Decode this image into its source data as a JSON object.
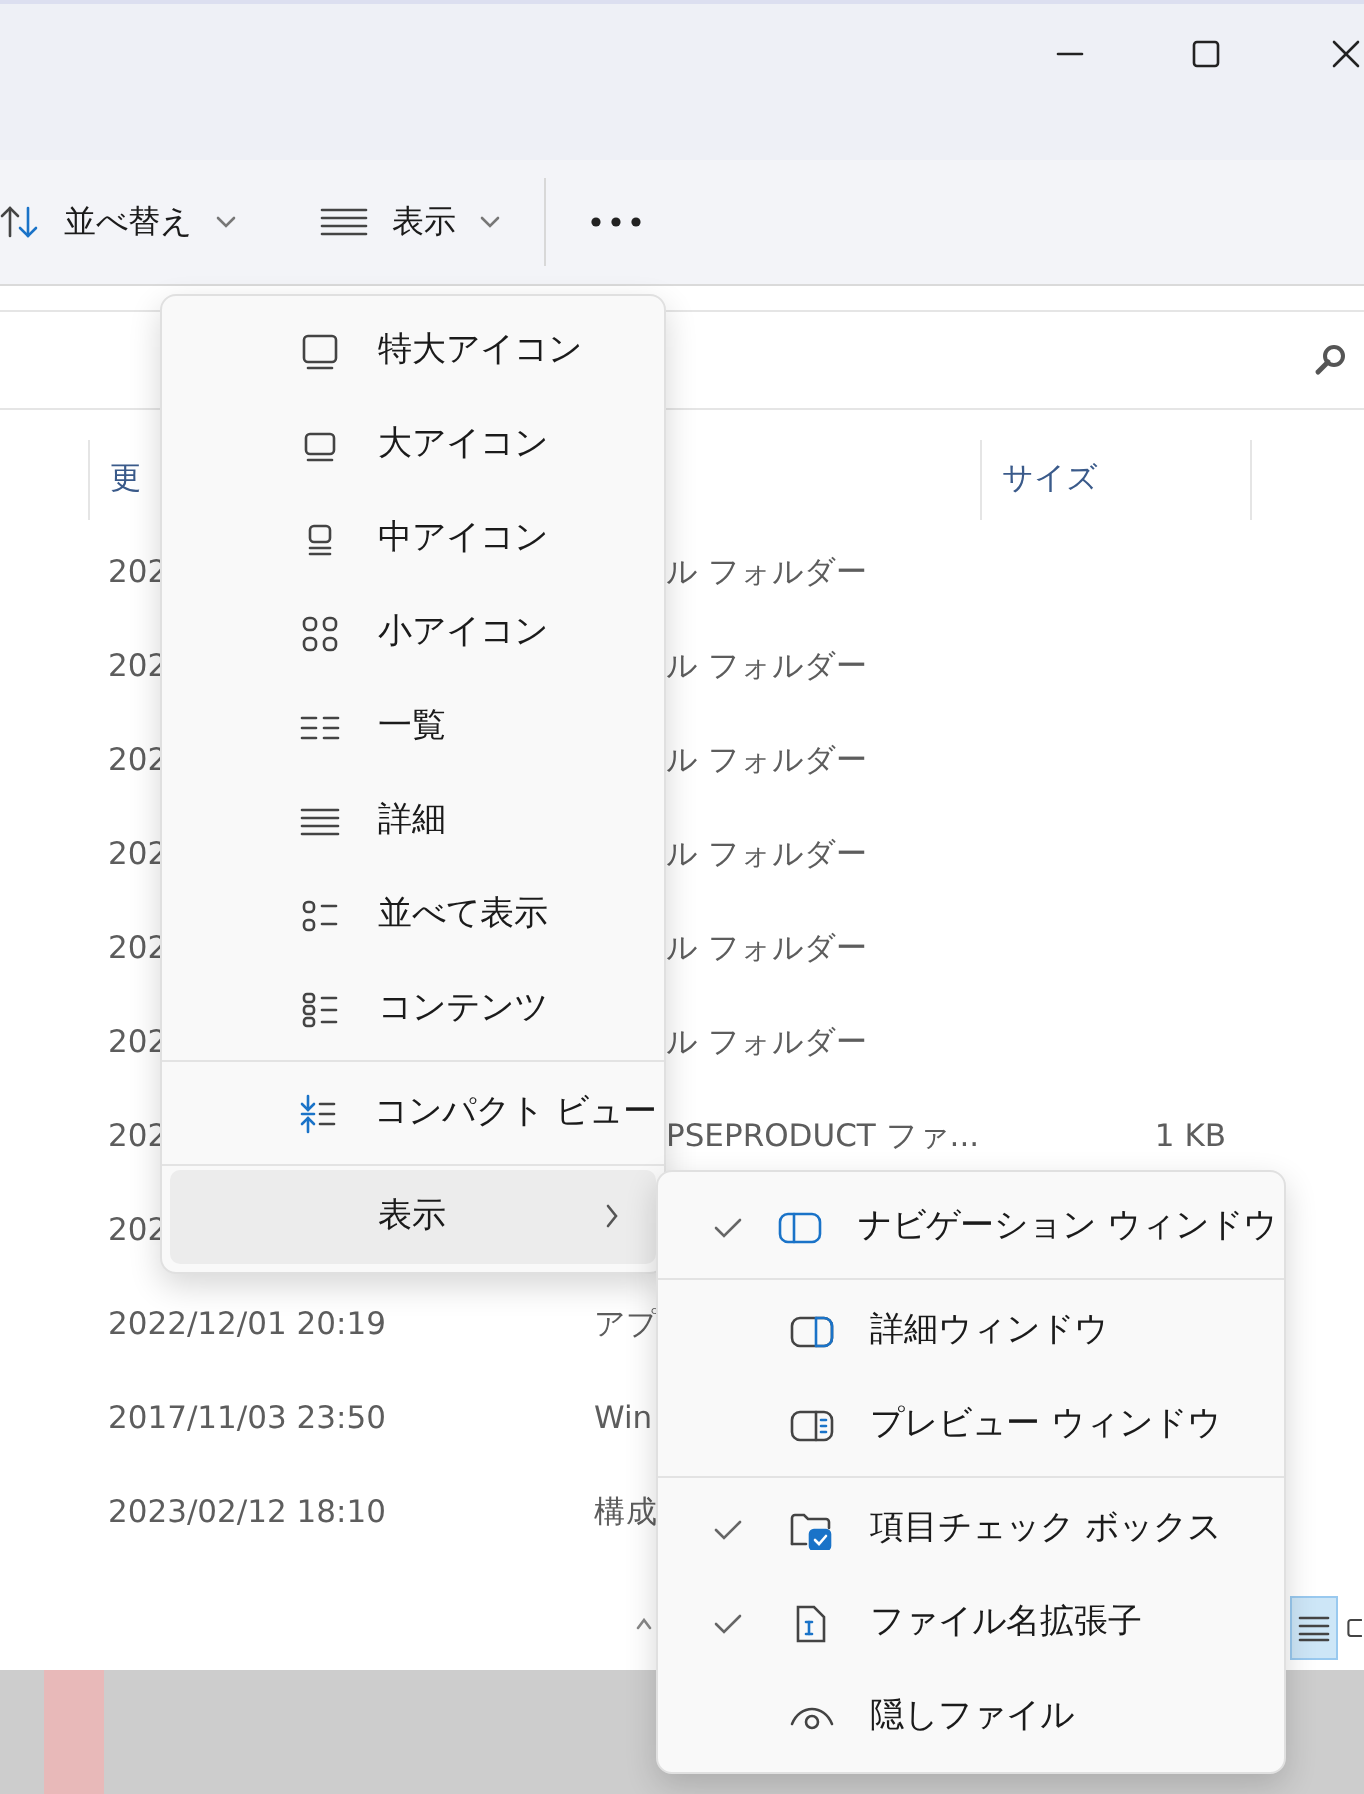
{
  "toolbar": {
    "items": [
      {
        "kind": "sort",
        "label": "並べ替え"
      },
      {
        "kind": "view",
        "label": "表示"
      },
      {
        "kind": "more"
      }
    ]
  },
  "file_list": {
    "columns": [
      {
        "kind": "date",
        "label": "更"
      },
      {
        "kind": "size",
        "label": "サイズ"
      }
    ],
    "rows": [
      {
        "date": "202",
        "type": "ル フォルダー",
        "covered": true
      },
      {
        "date": "202",
        "type": "ル フォルダー",
        "covered": true
      },
      {
        "date": "202",
        "type": "ル フォルダー",
        "covered": true
      },
      {
        "date": "202",
        "type": "ル フォルダー",
        "covered": true
      },
      {
        "date": "202",
        "type": "ル フォルダー",
        "covered": true
      },
      {
        "date": "202",
        "type": "ル フォルダー",
        "covered": true
      },
      {
        "date": "202",
        "type": "PSEPRODUCT ファ...",
        "size": "1 KB",
        "covered": true
      },
      {
        "date": "202"
      },
      {
        "date": "2022/12/01 20:19",
        "type": "アプ",
        "covered": false
      },
      {
        "date": "2017/11/03 23:50",
        "type": "Win",
        "covered": false
      },
      {
        "date": "2023/02/12 18:10",
        "type": "構成",
        "covered": false
      }
    ]
  },
  "view_menu": {
    "items": [
      {
        "kind": "option",
        "label": "特大アイコン",
        "highlighted": false
      },
      {
        "kind": "option",
        "label": "大アイコン",
        "highlighted": false
      },
      {
        "kind": "option",
        "label": "中アイコン",
        "highlighted": false
      },
      {
        "kind": "option",
        "label": "小アイコン",
        "highlighted": false
      },
      {
        "kind": "option",
        "label": "一覧",
        "highlighted": false
      },
      {
        "kind": "option",
        "label": "詳細",
        "highlighted": false
      },
      {
        "kind": "option",
        "label": "並べて表示",
        "highlighted": false
      },
      {
        "kind": "option",
        "label": "コンテンツ",
        "highlighted": false
      },
      {
        "kind": "separator"
      },
      {
        "kind": "option",
        "label": "コンパクト ビュー",
        "highlighted": false
      },
      {
        "kind": "separator"
      },
      {
        "kind": "submenu",
        "label": "表示",
        "highlighted": true
      }
    ]
  },
  "show_submenu": {
    "items": [
      {
        "kind": "toggle",
        "label": "ナビゲーション ウィンドウ",
        "checked": true
      },
      {
        "kind": "separator"
      },
      {
        "kind": "toggle",
        "label": "詳細ウィンドウ",
        "checked": false
      },
      {
        "kind": "toggle",
        "label": "プレビュー ウィンドウ",
        "checked": false
      },
      {
        "kind": "separator"
      },
      {
        "kind": "toggle",
        "label": "項目チェック ボックス",
        "checked": true
      },
      {
        "kind": "toggle",
        "label": "ファイル名拡張子",
        "checked": true
      },
      {
        "kind": "toggle",
        "label": "隠しファイル",
        "checked": false
      }
    ]
  }
}
